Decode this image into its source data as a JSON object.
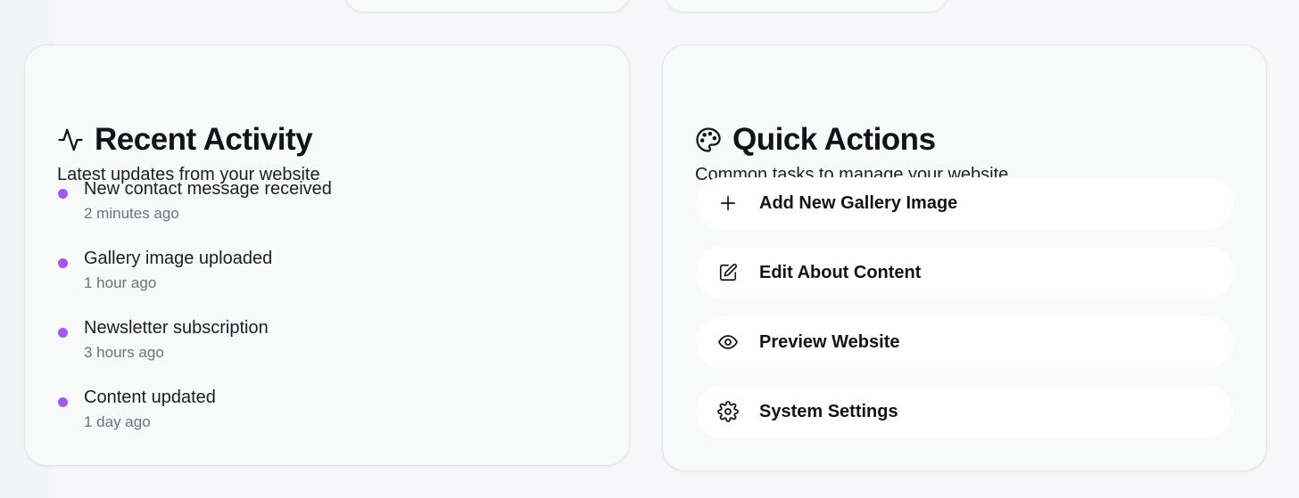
{
  "recent_activity": {
    "title": "Recent Activity",
    "subtitle": "Latest updates from your website",
    "icon": "activity-icon",
    "accent_color": "#a855f7",
    "items": [
      {
        "title": "New contact message received",
        "time": "2 minutes ago"
      },
      {
        "title": "Gallery image uploaded",
        "time": "1 hour ago"
      },
      {
        "title": "Newsletter subscription",
        "time": "3 hours ago"
      },
      {
        "title": "Content updated",
        "time": "1 day ago"
      }
    ]
  },
  "quick_actions": {
    "title": "Quick Actions",
    "subtitle": "Common tasks to manage your website",
    "icon": "palette-icon",
    "actions": [
      {
        "label": "Add New Gallery Image",
        "icon": "plus-icon"
      },
      {
        "label": "Edit About Content",
        "icon": "edit-icon"
      },
      {
        "label": "Preview Website",
        "icon": "eye-icon"
      },
      {
        "label": "System Settings",
        "icon": "gear-icon"
      }
    ]
  }
}
